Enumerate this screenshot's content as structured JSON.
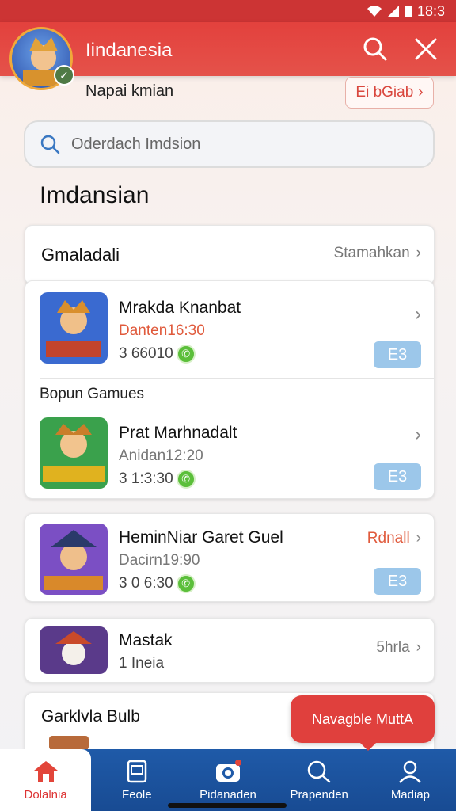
{
  "status_bar": {
    "time": "18:3"
  },
  "header": {
    "title": "Iindanesia"
  },
  "subheader": {
    "label": "Napai kmian",
    "pill": "Ei bGiab"
  },
  "search": {
    "placeholder": "Oderdach Imdsion"
  },
  "section": {
    "title": "Imdansian"
  },
  "card1": {
    "title": "Gmaladali",
    "link": "Stamahkan",
    "games": [
      {
        "title": "Mrakda Knanbat",
        "time": "Danten16:30",
        "meta": "3 66010",
        "tag": "E3",
        "time_color": "#e05a3c"
      },
      {
        "title": "Prat Marhnadalt",
        "time": "Anidan12:20",
        "meta": "3 1:3:30",
        "tag": "E3",
        "time_color": "#777777"
      }
    ],
    "group_label": "Bopun Gamues"
  },
  "card2": {
    "title": "HeminNiar Garet Guel",
    "time": "Dacirn19:90",
    "meta": "3 0 6:30",
    "status": "Rdnall",
    "tag": "E3"
  },
  "card3": {
    "title": "Mastak",
    "sub": "1 Ineia",
    "link": "5hrla"
  },
  "card4": {
    "title": "Garklvla Bulb"
  },
  "toast": {
    "text": "Navagble MuttA"
  },
  "bottom_nav": [
    {
      "label": "Dolalnia",
      "icon": "home-icon"
    },
    {
      "label": "Feole",
      "icon": "tablet-icon"
    },
    {
      "label": "Pidanaden",
      "icon": "camera-icon"
    },
    {
      "label": "Prapenden",
      "icon": "search-icon"
    },
    {
      "label": "Madiap",
      "icon": "profile-icon"
    }
  ],
  "colors": {
    "primary_red": "#e3413d",
    "nav_blue": "#1f5aa8",
    "tag_blue": "#9cc7ea"
  }
}
